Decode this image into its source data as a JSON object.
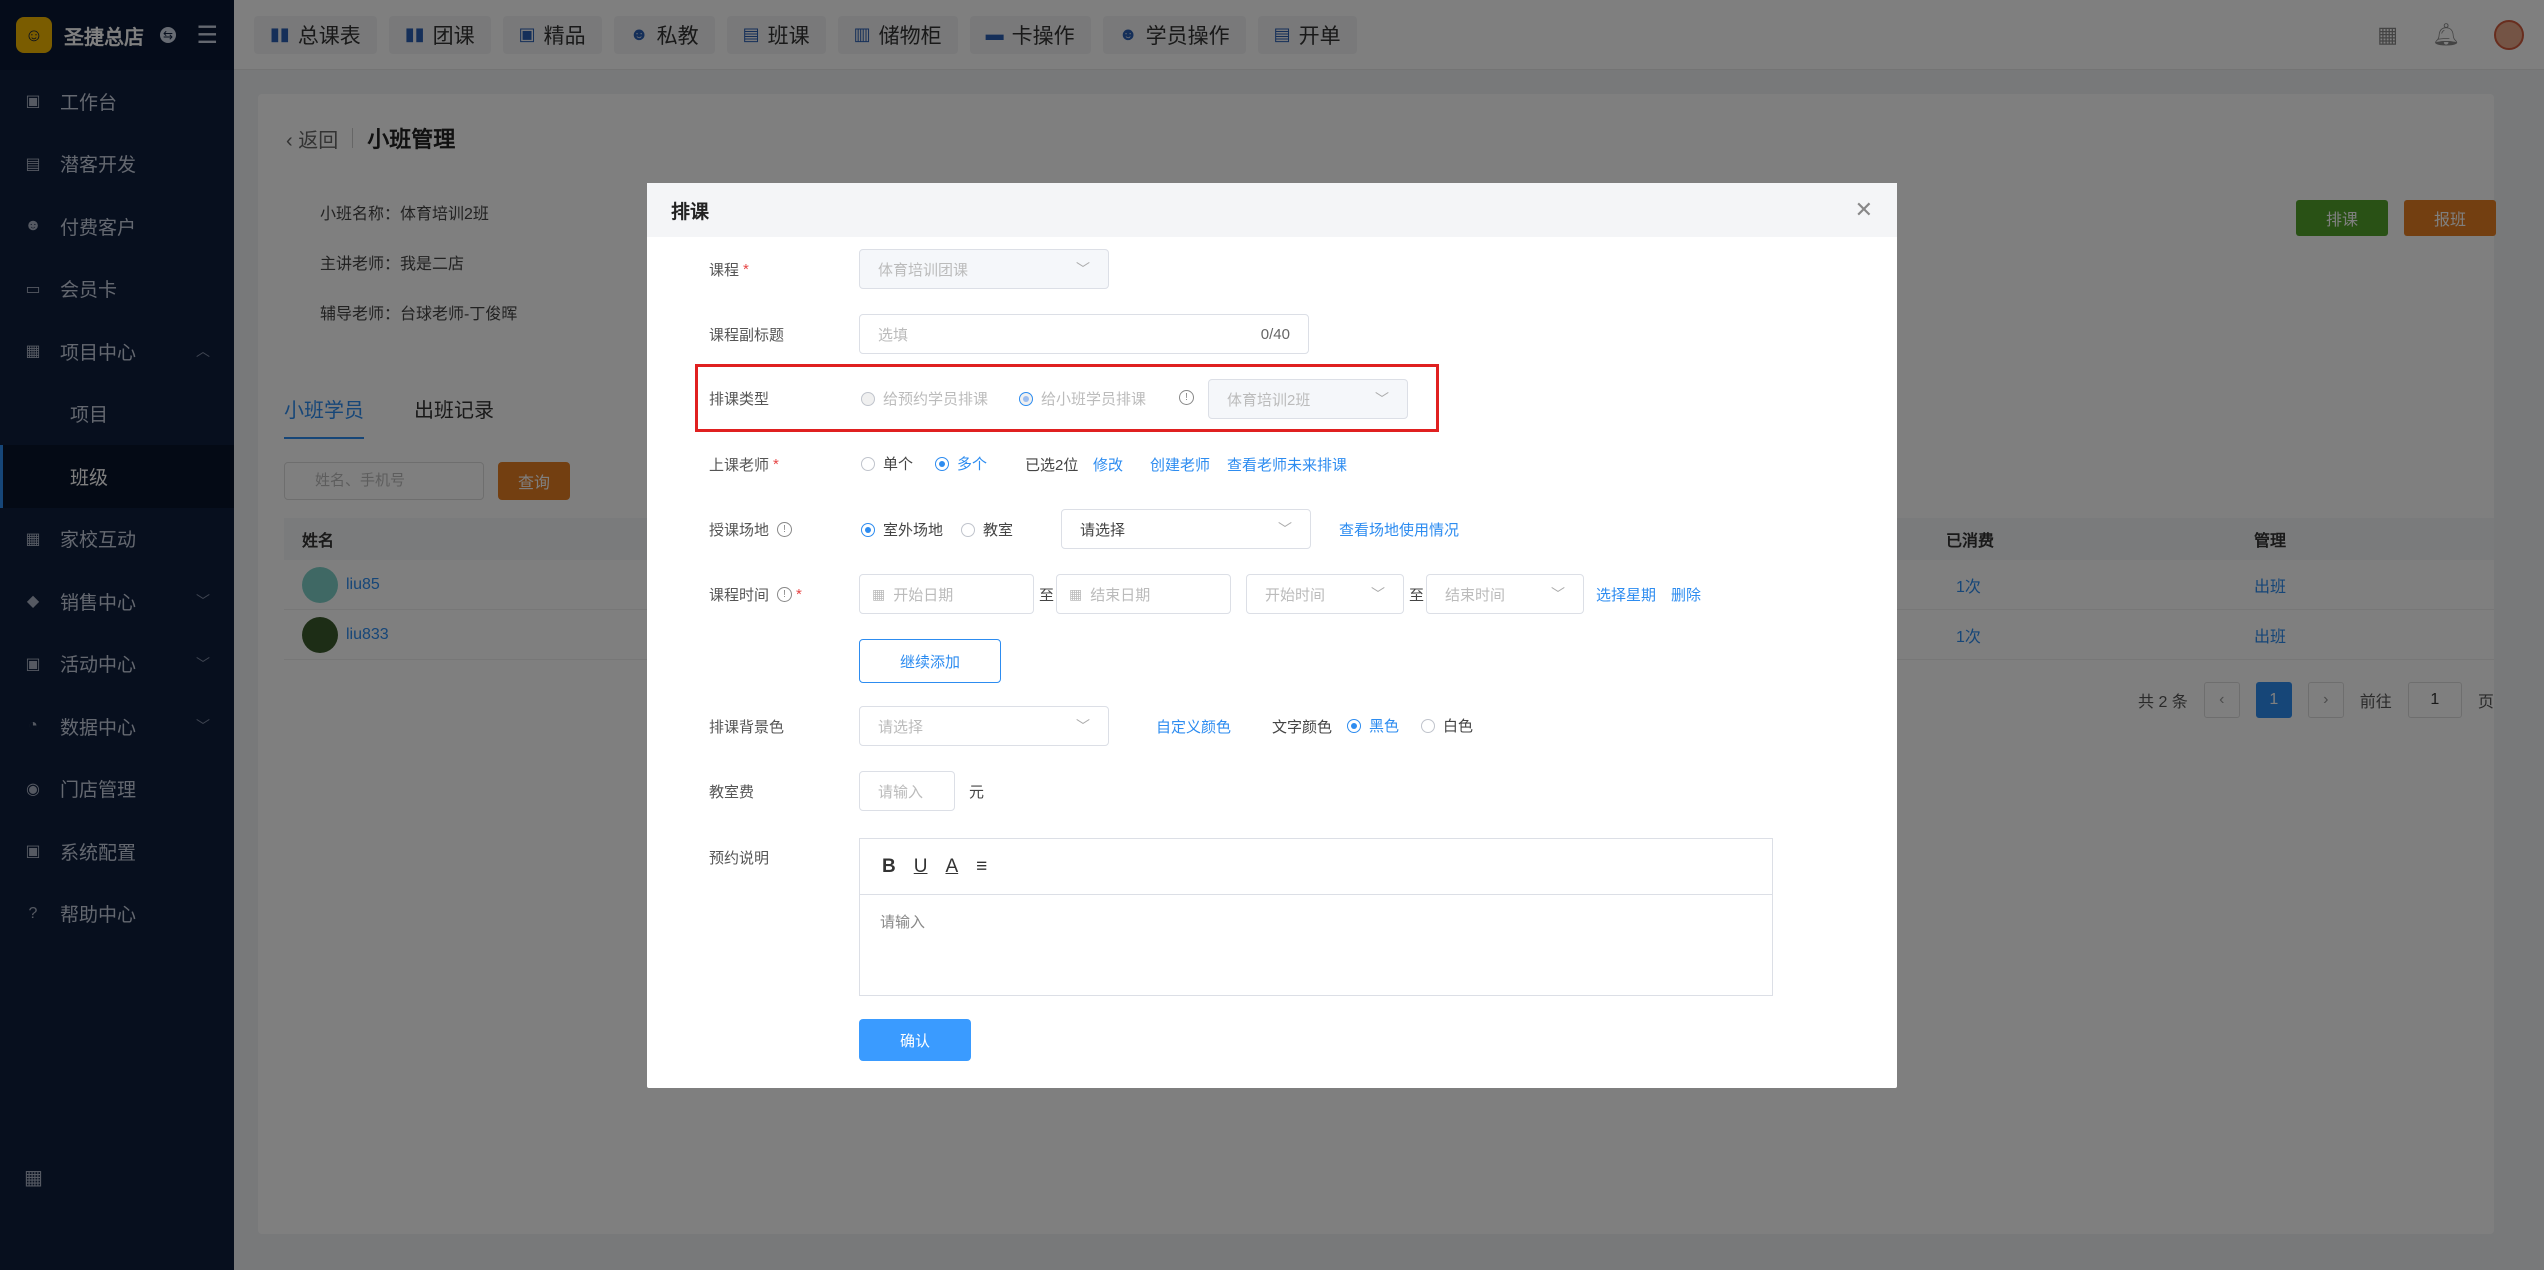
{
  "brand": {
    "name": "圣捷总店",
    "badge": "⇆"
  },
  "sidebar": {
    "items": [
      {
        "label": "工作台",
        "icon": "workbench-icon"
      },
      {
        "label": "潜客开发",
        "icon": "prospect-icon"
      },
      {
        "label": "付费客户",
        "icon": "customer-icon"
      },
      {
        "label": "会员卡",
        "icon": "card-icon"
      },
      {
        "label": "项目中心",
        "icon": "project-icon",
        "expanded": true
      },
      {
        "label": "项目",
        "sub": true
      },
      {
        "label": "班级",
        "sub": true,
        "active": true
      },
      {
        "label": "家校互动",
        "icon": "interaction-icon"
      },
      {
        "label": "销售中心",
        "icon": "sales-icon",
        "chevron": true
      },
      {
        "label": "活动中心",
        "icon": "activity-icon",
        "chevron": true
      },
      {
        "label": "数据中心",
        "icon": "data-icon",
        "chevron": true
      },
      {
        "label": "门店管理",
        "icon": "store-icon"
      },
      {
        "label": "系统配置",
        "icon": "settings-icon"
      },
      {
        "label": "帮助中心",
        "icon": "help-icon"
      }
    ]
  },
  "topbar": {
    "buttons": [
      {
        "label": "总课表",
        "icon": "book-icon"
      },
      {
        "label": "团课",
        "icon": "book-icon"
      },
      {
        "label": "精品",
        "icon": "star-icon"
      },
      {
        "label": "私教",
        "icon": "users-icon"
      },
      {
        "label": "班课",
        "icon": "class-icon"
      },
      {
        "label": "储物柜",
        "icon": "locker-icon"
      },
      {
        "label": "卡操作",
        "icon": "card-icon"
      },
      {
        "label": "学员操作",
        "icon": "user-icon"
      },
      {
        "label": "开单",
        "icon": "order-icon"
      }
    ]
  },
  "page": {
    "back": "返回",
    "title": "小班管理",
    "class_name": "小班名称：体育培训2班",
    "teacher": "主讲老师：我是二店",
    "assistant": "辅导老师：台球老师-丁俊晖",
    "schedule_btn": "排课",
    "enroll_btn": "报班",
    "tabs": [
      "小班学员",
      "出班记录"
    ],
    "search_placeholder": "姓名、手机号",
    "search_btn": "查询",
    "table": {
      "headers": {
        "name": "姓名",
        "consumed": "已消费",
        "manage": "管理"
      },
      "rows": [
        {
          "name": "liu85",
          "consumed": "1次",
          "action": "出班"
        },
        {
          "name": "liu833",
          "consumed": "1次",
          "action": "出班"
        }
      ]
    },
    "pager": {
      "total": "共 2 条",
      "current": "1",
      "goto": "前往",
      "goto_value": "1",
      "page_unit": "页",
      "prev": "‹",
      "next": "›"
    }
  },
  "modal": {
    "title": "排课",
    "course_label": "课程",
    "course_value": "体育培训团课",
    "subtitle_label": "课程副标题",
    "subtitle_placeholder": "选填",
    "subtitle_count": "0/40",
    "type_label": "排课类型",
    "type_opt1": "给预约学员排课",
    "type_opt2": "给小班学员排课",
    "type_class": "体育培训2班",
    "teacher_label": "上课老师",
    "teacher_single": "单个",
    "teacher_multi": "多个",
    "teacher_selected": "已选2位",
    "teacher_edit": "修改",
    "teacher_create": "创建老师",
    "teacher_view": "查看老师未来排课",
    "venue_label": "授课场地",
    "venue_outdoor": "室外场地",
    "venue_room": "教室",
    "venue_select": "请选择",
    "venue_usage": "查看场地使用情况",
    "time_label": "课程时间",
    "start_date": "开始日期",
    "to": "至",
    "end_date": "结束日期",
    "start_time": "开始时间",
    "end_time": "结束时间",
    "choose_week": "选择星期",
    "delete": "删除",
    "continue_add": "继续添加",
    "bg_label": "排课背景色",
    "bg_select": "请选择",
    "custom_color": "自定义颜色",
    "text_color_label": "文字颜色",
    "text_black": "黑色",
    "text_white": "白色",
    "fee_label": "教室费",
    "fee_placeholder": "请输入",
    "fee_unit": "元",
    "note_label": "预约说明",
    "note_placeholder": "请输入",
    "confirm": "确认"
  },
  "colors": {
    "primary": "#2d8cf0",
    "sidebar": "#0e1e3d",
    "highlight": "#e02020",
    "green": "#52a32b",
    "orange": "#e67e22"
  }
}
